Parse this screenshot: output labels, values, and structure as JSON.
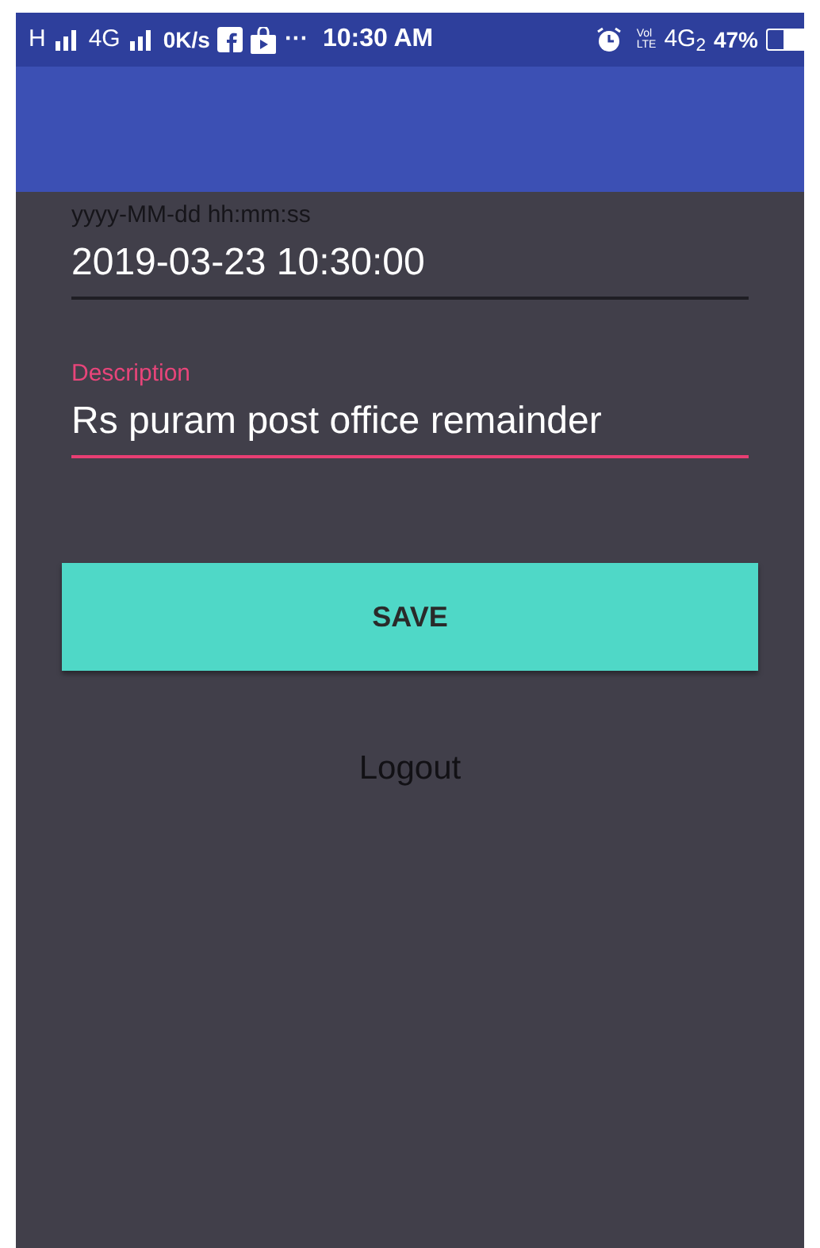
{
  "status_bar": {
    "network_1": "H",
    "network_2": "4G",
    "speed": "0K/s",
    "more": "···",
    "time": "10:30 AM",
    "volte": [
      "Vol",
      "LTE"
    ],
    "network_3": "4G$_{2}$",
    "battery": "47%"
  },
  "fields": [
    {
      "label": "yyyy-MM-dd hh:mm:ss",
      "value": "2019-03-23 10:30:00",
      "focused": false
    },
    {
      "label": "Description",
      "value": "Rs puram post office remainder",
      "focused": true
    }
  ],
  "save_button": "SAVE",
  "logout_link": "Logout"
}
